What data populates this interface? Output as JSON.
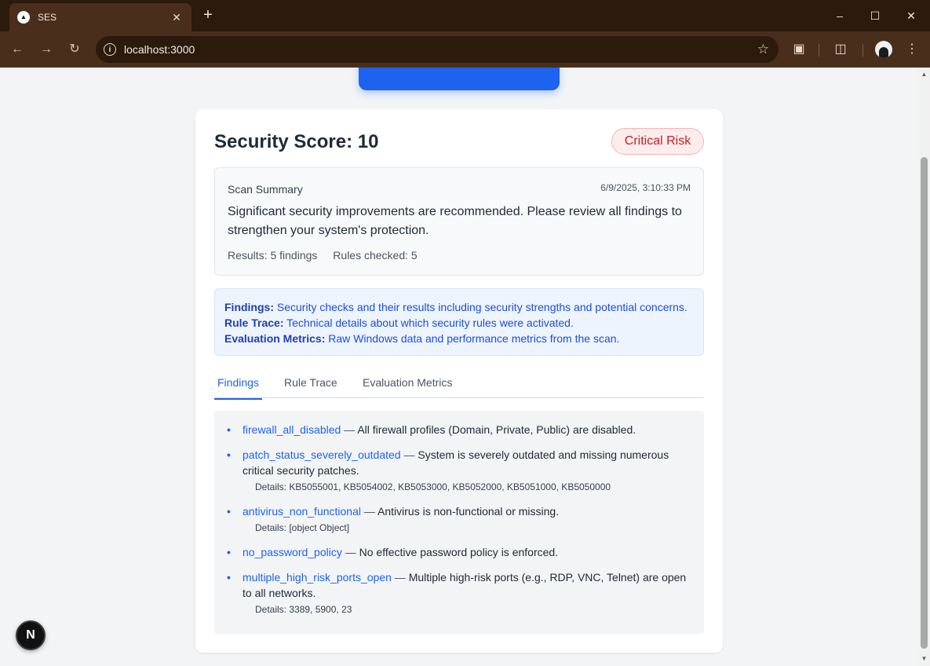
{
  "browser": {
    "tab_title": "SES",
    "favicon_glyph": "▲",
    "url": "localhost:3000",
    "new_tab_glyph": "+",
    "close_glyph": "✕"
  },
  "score": {
    "title": "Security Score: 10",
    "risk_label": "Critical Risk"
  },
  "summary": {
    "label": "Scan Summary",
    "timestamp": "6/9/2025, 3:10:33 PM",
    "text": "Significant security improvements are recommended. Please review all findings to strengthen your system's protection.",
    "results": "Results: 5 findings",
    "rules": "Rules checked: 5"
  },
  "info": [
    {
      "term": "Findings:",
      "desc": " Security checks and their results including security strengths and potential concerns."
    },
    {
      "term": "Rule Trace:",
      "desc": " Technical details about which security rules were activated."
    },
    {
      "term": "Evaluation Metrics:",
      "desc": " Raw Windows data and performance metrics from the scan."
    }
  ],
  "tabs": [
    "Findings",
    "Rule Trace",
    "Evaluation Metrics"
  ],
  "findings": [
    {
      "name": "firewall_all_disabled",
      "desc": "All firewall profiles (Domain, Private, Public) are disabled.",
      "details": ""
    },
    {
      "name": "patch_status_severely_outdated",
      "desc": "System is severely outdated and missing numerous critical security patches.",
      "details": "Details: KB5055001, KB5054002, KB5053000, KB5052000, KB5051000, KB5050000"
    },
    {
      "name": "antivirus_non_functional",
      "desc": "Antivirus is non-functional or missing.",
      "details": "Details: [object Object]"
    },
    {
      "name": "no_password_policy",
      "desc": "No effective password policy is enforced.",
      "details": ""
    },
    {
      "name": "multiple_high_risk_ports_open",
      "desc": "Multiple high-risk ports (e.g., RDP, VNC, Telnet) are open to all networks.",
      "details": "Details: 3389, 5900, 23"
    }
  ],
  "separator": " — ",
  "next_badge": "N"
}
